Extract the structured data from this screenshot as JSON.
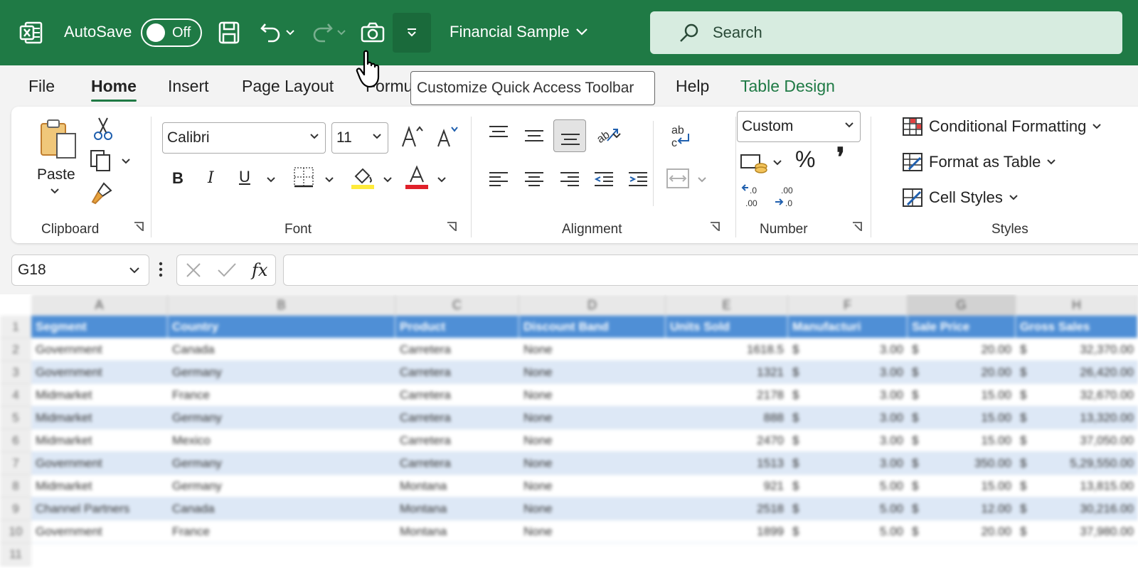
{
  "titlebar": {
    "autosave_label": "AutoSave",
    "autosave_state": "Off",
    "file_name": "Financial Sample",
    "search_placeholder": "Search",
    "brand_color": "#1f7a45"
  },
  "tooltip": "Customize Quick Access Toolbar",
  "tabs": [
    {
      "label": "File"
    },
    {
      "label": "Home"
    },
    {
      "label": "Insert"
    },
    {
      "label": "Page Layout"
    },
    {
      "label": "Formu"
    },
    {
      "label": "Help"
    },
    {
      "label": "Table Design"
    }
  ],
  "ribbon": {
    "clipboard": {
      "paste_label": "Paste",
      "group_label": "Clipboard"
    },
    "font": {
      "font_name": "Calibri",
      "font_size": "11",
      "group_label": "Font"
    },
    "alignment": {
      "group_label": "Alignment"
    },
    "number": {
      "format": "Custom",
      "group_label": "Number",
      "percent": "%",
      "comma": "❜"
    },
    "styles": {
      "group_label": "Styles",
      "conditional_formatting": "Conditional Formatting",
      "format_as_table": "Format as Table",
      "cell_styles": "Cell Styles"
    }
  },
  "formula_bar": {
    "name_box": "G18",
    "fx": "fx",
    "formula": ""
  },
  "sheet": {
    "columns": [
      "A",
      "B",
      "C",
      "D",
      "E",
      "F",
      "G",
      "H"
    ],
    "headers": [
      "Segment",
      "Country",
      "Product",
      "Discount Band",
      "Units Sold",
      "Manufacturi",
      "Sale Price",
      "Gross Sales"
    ],
    "row_numbers": [
      "1",
      "2",
      "3",
      "4",
      "5",
      "6",
      "7",
      "8",
      "9",
      "10",
      "11"
    ],
    "rows": [
      [
        "Government",
        "Canada",
        "Carretera",
        "None",
        "1618.5",
        "$",
        "3.00",
        "$",
        "20.00",
        "$",
        "32,370.00"
      ],
      [
        "Government",
        "Germany",
        "Carretera",
        "None",
        "1321",
        "$",
        "3.00",
        "$",
        "20.00",
        "$",
        "26,420.00"
      ],
      [
        "Midmarket",
        "France",
        "Carretera",
        "None",
        "2178",
        "$",
        "3.00",
        "$",
        "15.00",
        "$",
        "32,670.00"
      ],
      [
        "Midmarket",
        "Germany",
        "Carretera",
        "None",
        "888",
        "$",
        "3.00",
        "$",
        "15.00",
        "$",
        "13,320.00"
      ],
      [
        "Midmarket",
        "Mexico",
        "Carretera",
        "None",
        "2470",
        "$",
        "3.00",
        "$",
        "15.00",
        "$",
        "37,050.00"
      ],
      [
        "Government",
        "Germany",
        "Carretera",
        "None",
        "1513",
        "$",
        "3.00",
        "$",
        "350.00",
        "$",
        "5,29,550.00"
      ],
      [
        "Midmarket",
        "Germany",
        "Montana",
        "None",
        "921",
        "$",
        "5.00",
        "$",
        "15.00",
        "$",
        "13,815.00"
      ],
      [
        "Channel Partners",
        "Canada",
        "Montana",
        "None",
        "2518",
        "$",
        "5.00",
        "$",
        "12.00",
        "$",
        "30,216.00"
      ],
      [
        "Government",
        "France",
        "Montana",
        "None",
        "1899",
        "$",
        "5.00",
        "$",
        "20.00",
        "$",
        "37,980.00"
      ]
    ]
  }
}
